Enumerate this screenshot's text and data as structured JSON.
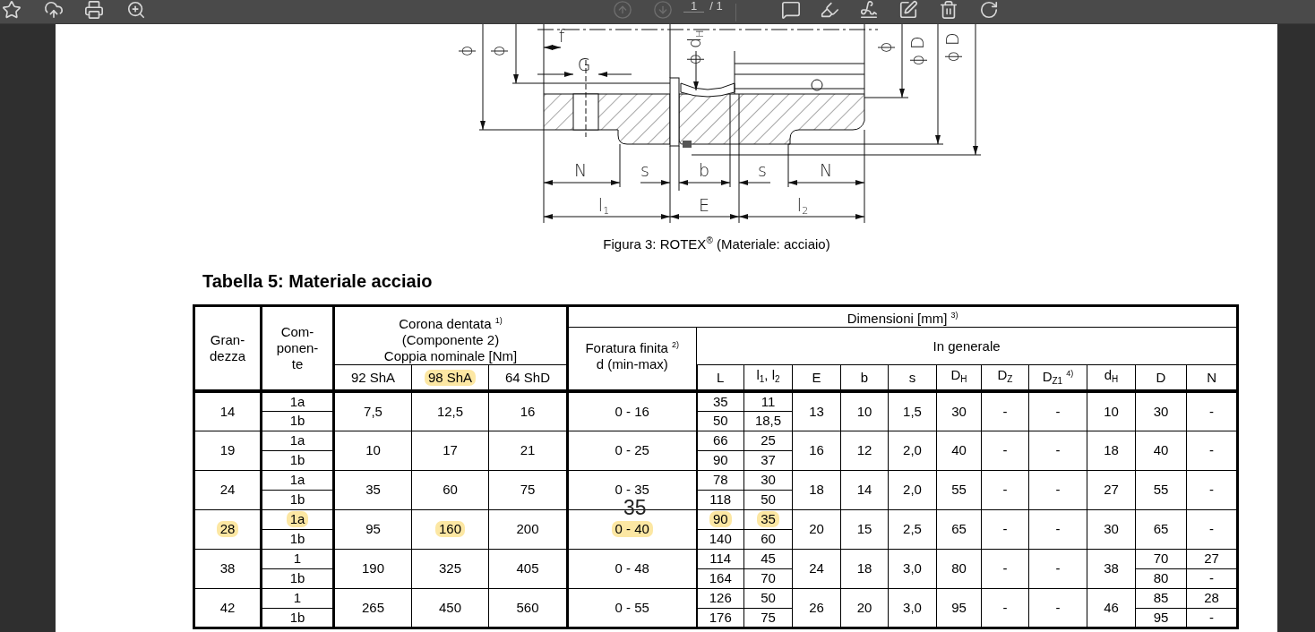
{
  "toolbar": {
    "nav_buttons": [
      {
        "disabled": true
      },
      {
        "disabled": true
      }
    ],
    "page_input": "1",
    "page_total": "/ 1"
  },
  "figure": {
    "labels": [
      {
        "kind": "rotated",
        "text": "ϕ"
      },
      {
        "kind": "rotated",
        "text": "ϕ"
      },
      {
        "kind": "plain",
        "text": "f"
      },
      {
        "kind": "plain",
        "text": "G"
      },
      {
        "kind": "rotated",
        "text": "ϕ d$_{H}$"
      },
      {
        "kind": "rotated",
        "text": "ϕ"
      },
      {
        "kind": "rotated",
        "text": "ϕ D"
      },
      {
        "kind": "rotated",
        "text": "ϕ D"
      },
      {
        "kind": "plain",
        "text": "N"
      },
      {
        "kind": "plain",
        "text": "s"
      },
      {
        "kind": "plain",
        "text": "b"
      },
      {
        "kind": "plain",
        "text": "s"
      },
      {
        "kind": "plain",
        "text": "N"
      },
      {
        "kind": "plain",
        "text": "l$_{1}$"
      },
      {
        "kind": "plain",
        "text": "E"
      },
      {
        "kind": "plain",
        "text": "l$_{2}$"
      }
    ],
    "caption": "Figura 3: ROTEX$^{®}$ (Materiale: acciaio)"
  },
  "page_number": "35",
  "table": {
    "title": "Tabella 5: Materiale acciaio",
    "header": {
      "size": "Gran-\ndezza",
      "component": "Com-\nponen-\nte",
      "torque_group": "Corona dentata $^{1)}$\n(Componente 2)\nCoppia nominale [Nm]",
      "torque_columns": [
        {
          "text": "92 ShA",
          "highlighted": false
        },
        {
          "text": "98 ShA",
          "highlighted": true
        },
        {
          "text": "64 ShD",
          "highlighted": false
        }
      ],
      "dimensions_group": "Dimensioni [mm] $^{3)}$",
      "bore": "Foratura finita $^{2)}$\nd (min-max)",
      "general_group": "In generale",
      "dimension_columns": [
        "L",
        "l$_{1}$, l$_{2}$",
        "E",
        "b",
        "s",
        "D$_{H}$",
        "D$_{Z}$",
        "D$_{Z1}$ $^{4)}$",
        "d$_{H}$",
        "D",
        "N"
      ]
    },
    "rows": [
      {
        "size": {
          "text": "14",
          "highlighted": false
        },
        "parts": [
          {
            "component": {
              "text": "1a",
              "highlighted": false
            },
            "L": {
              "text": "35",
              "highlighted": false
            },
            "l": {
              "text": "11",
              "highlighted": false
            }
          },
          {
            "component": {
              "text": "1b",
              "highlighted": false
            },
            "L": {
              "text": "50",
              "highlighted": false
            },
            "l": {
              "text": "18,5",
              "highlighted": false
            }
          }
        ],
        "torque": [
          {
            "text": "7,5",
            "highlighted": false
          },
          {
            "text": "12,5",
            "highlighted": false
          },
          {
            "text": "16",
            "highlighted": false
          }
        ],
        "bore": {
          "text": "0 - 16",
          "highlighted": false
        },
        "E": "13",
        "b": "10",
        "s": "1,5",
        "DH": "30",
        "DZ": "-",
        "DZ1": "-",
        "dH": "10",
        "D": "30",
        "N": "-"
      },
      {
        "size": {
          "text": "19",
          "highlighted": false
        },
        "parts": [
          {
            "component": {
              "text": "1a",
              "highlighted": false
            },
            "L": {
              "text": "66",
              "highlighted": false
            },
            "l": {
              "text": "25",
              "highlighted": false
            }
          },
          {
            "component": {
              "text": "1b",
              "highlighted": false
            },
            "L": {
              "text": "90",
              "highlighted": false
            },
            "l": {
              "text": "37",
              "highlighted": false
            }
          }
        ],
        "torque": [
          {
            "text": "10",
            "highlighted": false
          },
          {
            "text": "17",
            "highlighted": false
          },
          {
            "text": "21",
            "highlighted": false
          }
        ],
        "bore": {
          "text": "0 - 25",
          "highlighted": false
        },
        "E": "16",
        "b": "12",
        "s": "2,0",
        "DH": "40",
        "DZ": "-",
        "DZ1": "-",
        "dH": "18",
        "D": "40",
        "N": "-"
      },
      {
        "size": {
          "text": "24",
          "highlighted": false
        },
        "parts": [
          {
            "component": {
              "text": "1a",
              "highlighted": false
            },
            "L": {
              "text": "78",
              "highlighted": false
            },
            "l": {
              "text": "30",
              "highlighted": false
            }
          },
          {
            "component": {
              "text": "1b",
              "highlighted": false
            },
            "L": {
              "text": "118",
              "highlighted": false
            },
            "l": {
              "text": "50",
              "highlighted": false
            }
          }
        ],
        "torque": [
          {
            "text": "35",
            "highlighted": false
          },
          {
            "text": "60",
            "highlighted": false
          },
          {
            "text": "75",
            "highlighted": false
          }
        ],
        "bore": {
          "text": "0 - 35",
          "highlighted": false
        },
        "E": "18",
        "b": "14",
        "s": "2,0",
        "DH": "55",
        "DZ": "-",
        "DZ1": "-",
        "dH": "27",
        "D": "55",
        "N": "-"
      },
      {
        "size": {
          "text": "28",
          "highlighted": true
        },
        "parts": [
          {
            "component": {
              "text": "1a",
              "highlighted": true
            },
            "L": {
              "text": "90",
              "highlighted": true
            },
            "l": {
              "text": "35",
              "highlighted": true
            }
          },
          {
            "component": {
              "text": "1b",
              "highlighted": false
            },
            "L": {
              "text": "140",
              "highlighted": false
            },
            "l": {
              "text": "60",
              "highlighted": false
            }
          }
        ],
        "torque": [
          {
            "text": "95",
            "highlighted": false
          },
          {
            "text": "160",
            "highlighted": true
          },
          {
            "text": "200",
            "highlighted": false
          }
        ],
        "bore": {
          "text": "0 - 40",
          "highlighted": true
        },
        "E": "20",
        "b": "15",
        "s": "2,5",
        "DH": "65",
        "DZ": "-",
        "DZ1": "-",
        "dH": "30",
        "D": "65",
        "N": "-"
      },
      {
        "size": {
          "text": "38",
          "highlighted": false
        },
        "parts": [
          {
            "component": {
              "text": "1",
              "highlighted": false
            },
            "L": {
              "text": "114",
              "highlighted": false
            },
            "l": {
              "text": "45",
              "highlighted": false
            },
            "D": "70",
            "N": "27"
          },
          {
            "component": {
              "text": "1b",
              "highlighted": false
            },
            "L": {
              "text": "164",
              "highlighted": false
            },
            "l": {
              "text": "70",
              "highlighted": false
            },
            "D": "80",
            "N": "-"
          }
        ],
        "torque": [
          {
            "text": "190",
            "highlighted": false
          },
          {
            "text": "325",
            "highlighted": false
          },
          {
            "text": "405",
            "highlighted": false
          }
        ],
        "bore": {
          "text": "0 - 48",
          "highlighted": false
        },
        "E": "24",
        "b": "18",
        "s": "3,0",
        "DH": "80",
        "DZ": "-",
        "DZ1": "-",
        "dH": "38"
      },
      {
        "size": {
          "text": "42",
          "highlighted": false
        },
        "parts": [
          {
            "component": {
              "text": "1",
              "highlighted": false
            },
            "L": {
              "text": "126",
              "highlighted": false
            },
            "l": {
              "text": "50",
              "highlighted": false
            },
            "D": "85",
            "N": "28"
          },
          {
            "component": {
              "text": "1b",
              "highlighted": false
            },
            "L": {
              "text": "176",
              "highlighted": false
            },
            "l": {
              "text": "75",
              "highlighted": false
            },
            "D": "95",
            "N": "-"
          }
        ],
        "torque": [
          {
            "text": "265",
            "highlighted": false
          },
          {
            "text": "450",
            "highlighted": false
          },
          {
            "text": "560",
            "highlighted": false
          }
        ],
        "bore": {
          "text": "0 - 55",
          "highlighted": false
        },
        "E": "26",
        "b": "20",
        "s": "3,0",
        "DH": "95",
        "DZ": "-",
        "DZ1": "-",
        "dH": "46"
      }
    ]
  }
}
